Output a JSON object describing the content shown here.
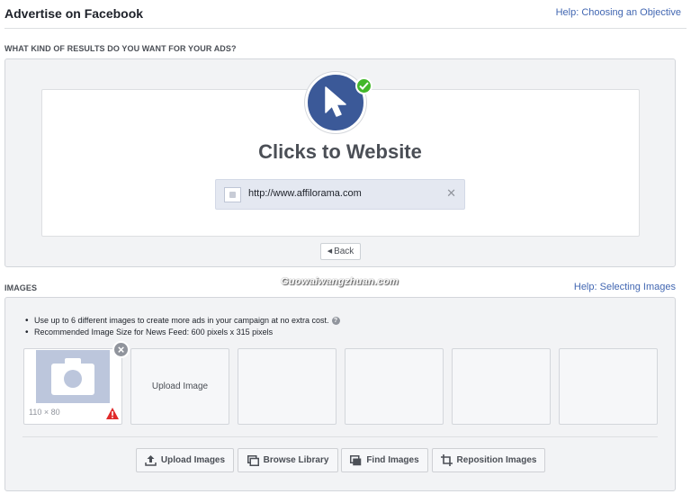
{
  "header": {
    "title": "Advertise on Facebook",
    "help_link": "Help: Choosing an Objective"
  },
  "objective": {
    "section_label": "WHAT KIND OF RESULTS DO YOU WANT FOR YOUR ADS?",
    "title": "Clicks to Website",
    "url": "http://www.affilorama.com",
    "back_label": "Back",
    "icon": "cursor-icon",
    "accent": "#3b5998",
    "check_color": "#42b72a"
  },
  "watermark": "Guowaiwangzhuan.com",
  "images": {
    "section_label": "IMAGES",
    "help_link": "Help: Selecting Images",
    "bullets": [
      "Use up to 6 different images to create more ads in your campaign at no extra cost.",
      "Recommended Image Size for News Feed: 600 pixels x 315 pixels"
    ],
    "slot_size": "110 × 80",
    "upload_slot_label": "Upload Image",
    "buttons": {
      "upload": "Upload Images",
      "browse": "Browse Library",
      "find": "Find Images",
      "reposition": "Reposition Images"
    }
  }
}
